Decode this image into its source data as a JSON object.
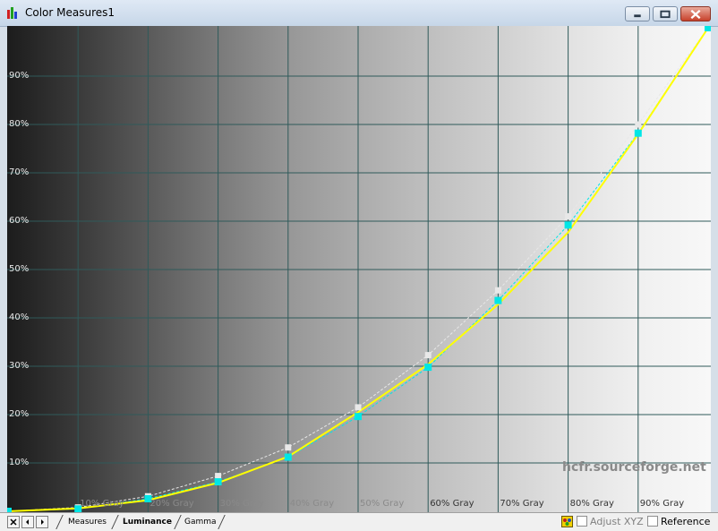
{
  "window": {
    "title": "Color Measures1",
    "buttons": {
      "minimize": "minimize-icon",
      "maximize": "maximize-icon",
      "close": "close-icon"
    }
  },
  "chart": {
    "watermark": "hcfr.sourceforge.net",
    "y_tick_labels": [
      "10%",
      "20%",
      "30%",
      "40%",
      "50%",
      "60%",
      "70%",
      "80%",
      "90%"
    ],
    "x_tick_labels": [
      "10% Gray",
      "20% Gray",
      "30% Gray",
      "40% Gray",
      "50% Gray",
      "60% Gray",
      "70% Gray",
      "80% Gray",
      "90% Gray"
    ]
  },
  "chart_data": {
    "type": "line",
    "x": [
      0,
      10,
      20,
      30,
      40,
      50,
      60,
      70,
      80,
      90,
      100
    ],
    "xlim": [
      0,
      100
    ],
    "ylim": [
      0,
      100
    ],
    "grid": true,
    "series": [
      {
        "color": "#ffff00",
        "values": [
          0,
          0.6,
          2.3,
          5.9,
          11.3,
          20.5,
          30.4,
          42.8,
          57.7,
          78.0,
          100
        ]
      },
      {
        "color": "#00e6e6",
        "values": [
          0,
          0.5,
          2.6,
          6.1,
          11.2,
          19.6,
          29.8,
          43.6,
          59.2,
          78.2,
          100
        ]
      },
      {
        "color": "#e8e8e8",
        "values": [
          0,
          0.8,
          3.1,
          7.3,
          13.2,
          21.5,
          32.3,
          45.7,
          61.0,
          80.0,
          100
        ]
      }
    ]
  },
  "tabs": {
    "items": [
      {
        "label": "Measures"
      },
      {
        "label": "Luminance"
      },
      {
        "label": "Gamma"
      }
    ],
    "active": "Luminance"
  },
  "status": {
    "adjust_label": "Adjust XYZ",
    "reference_label": "Reference"
  },
  "colors": {
    "grid": "#2f5a5a",
    "accent_yellow": "#ffff00",
    "accent_cyan": "#00e6e6",
    "reference": "#e8e8e8"
  }
}
